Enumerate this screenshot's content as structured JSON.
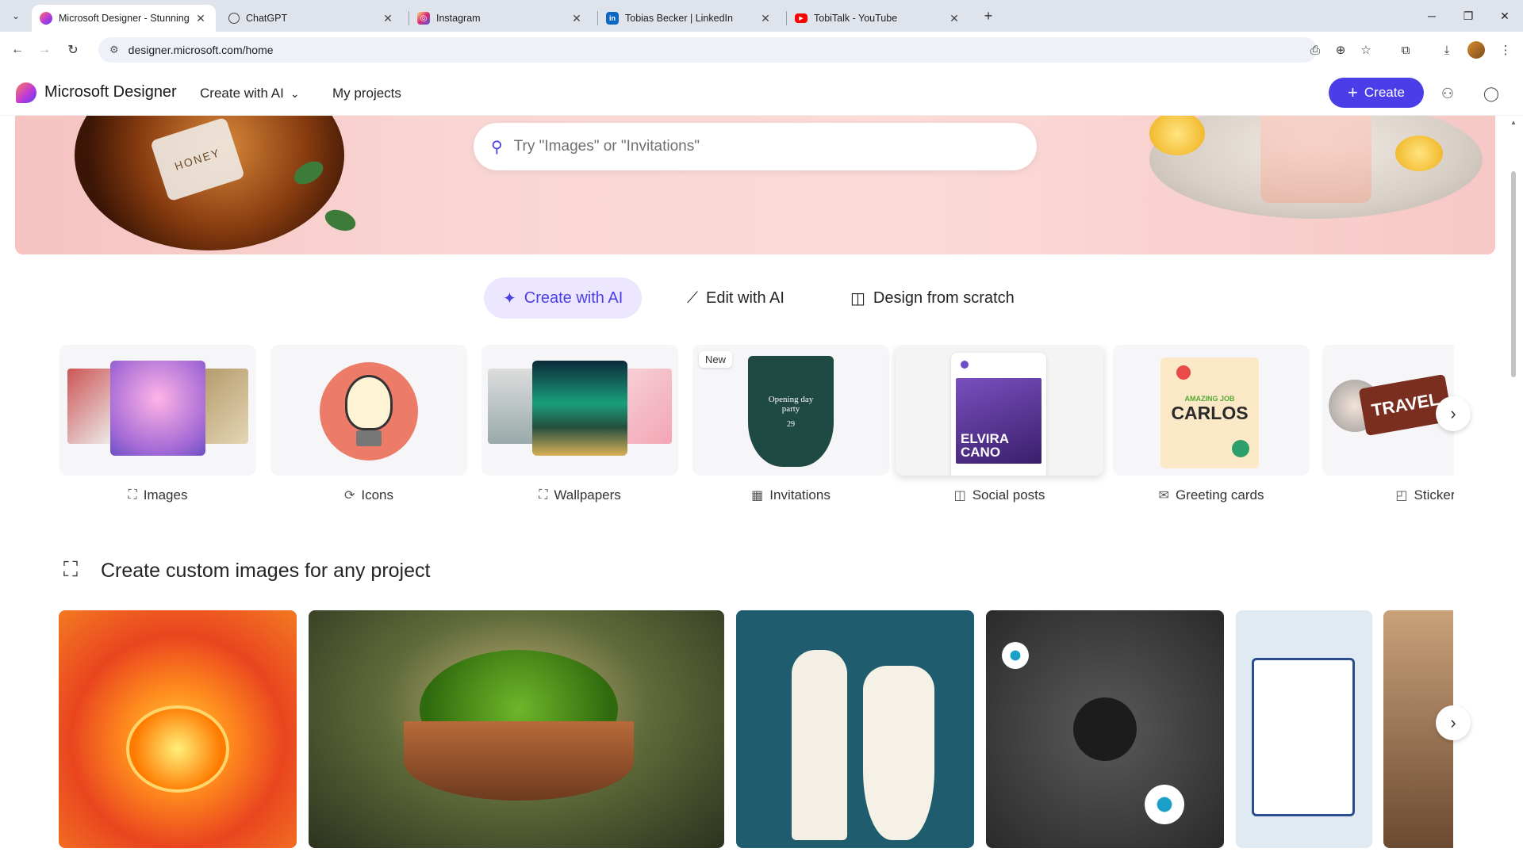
{
  "browser": {
    "tabs": [
      {
        "title": "Microsoft Designer - Stunning",
        "favicon": "designer-icon",
        "color": "#c13bd6"
      },
      {
        "title": "ChatGPT",
        "favicon": "chatgpt-icon",
        "color": "#444444"
      },
      {
        "title": "Instagram",
        "favicon": "instagram-icon",
        "color": "#e1306c"
      },
      {
        "title": "Tobias Becker | LinkedIn",
        "favicon": "linkedin-icon",
        "color": "#0a66c2"
      },
      {
        "title": "TobiTalk - YouTube",
        "favicon": "youtube-icon",
        "color": "#ff0000"
      }
    ],
    "url": "designer.microsoft.com/home"
  },
  "header": {
    "brand": "Microsoft Designer",
    "nav_create": "Create with AI",
    "nav_projects": "My projects",
    "create_button": "Create",
    "accent": "#4b3ee8"
  },
  "hero": {
    "search_placeholder": "Try \"Images\" or \"Invitations\"",
    "jar_label": "HONEY"
  },
  "modes": [
    {
      "label": "Create with AI",
      "icon": "sparkle-icon",
      "active": true
    },
    {
      "label": "Edit with AI",
      "icon": "magic-wand-icon",
      "active": false
    },
    {
      "label": "Design from scratch",
      "icon": "shapes-icon",
      "active": false
    }
  ],
  "categories": [
    {
      "label": "Images",
      "icon": "image-sparkle-icon"
    },
    {
      "label": "Icons",
      "icon": "icon-sparkle-icon"
    },
    {
      "label": "Wallpapers",
      "icon": "wallpaper-icon"
    },
    {
      "label": "Invitations",
      "icon": "calendar-icon",
      "badge": "New",
      "thumb_text": "Opening day party",
      "thumb_date": "29"
    },
    {
      "label": "Social posts",
      "icon": "social-post-icon",
      "thumb_name": "ELVIRA CANO"
    },
    {
      "label": "Greeting cards",
      "icon": "mail-icon",
      "thumb_top": "AMAZING JOB",
      "thumb_name": "CARLOS"
    },
    {
      "label": "Stickers",
      "icon": "sticker-icon",
      "thumb_text": "TRAVEL"
    }
  ],
  "section": {
    "title": "Create custom images for any project"
  }
}
